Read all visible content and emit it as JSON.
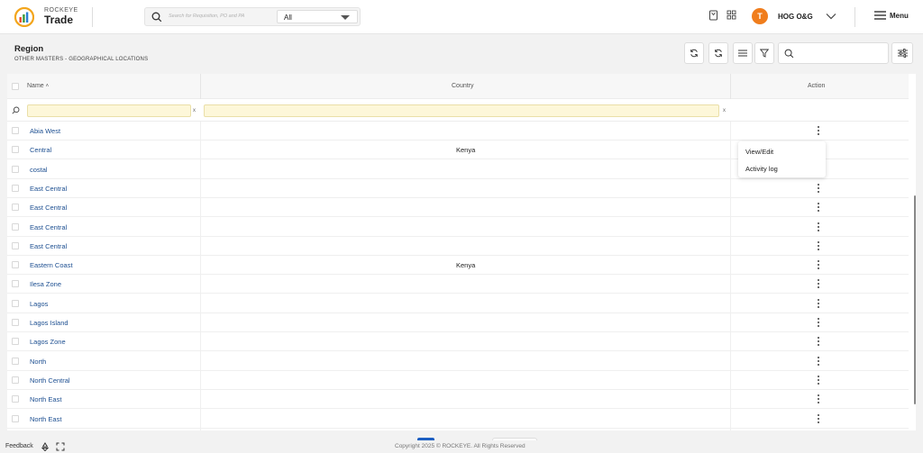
{
  "header": {
    "brand_small": "ROCKEYE",
    "brand_big": "Trade",
    "search_placeholder": "Search for Requisition, PO and PA",
    "search_scope": "All",
    "avatar_letter": "T",
    "user_name": "HOG O&G",
    "menu_label": "Menu"
  },
  "page": {
    "title": "Region",
    "breadcrumb": "OTHER MASTERS -  GEOGRAPHICAL LOCATIONS"
  },
  "grid": {
    "columns": {
      "name": "Name",
      "name_sort": "˄",
      "country": "Country",
      "action": "Action"
    },
    "filter_clear": "x",
    "rows": [
      {
        "name": "Abia West",
        "country": ""
      },
      {
        "name": "Central",
        "country": "Kenya"
      },
      {
        "name": "costal",
        "country": ""
      },
      {
        "name": "East Central",
        "country": ""
      },
      {
        "name": "East Central",
        "country": ""
      },
      {
        "name": "East Central",
        "country": ""
      },
      {
        "name": "East Central",
        "country": ""
      },
      {
        "name": "Eastern Coast",
        "country": "Kenya"
      },
      {
        "name": "Ilesa Zone",
        "country": ""
      },
      {
        "name": "Lagos",
        "country": ""
      },
      {
        "name": "Lagos Island",
        "country": ""
      },
      {
        "name": "Lagos Zone",
        "country": ""
      },
      {
        "name": "North",
        "country": ""
      },
      {
        "name": "North Central",
        "country": ""
      },
      {
        "name": "North East",
        "country": ""
      },
      {
        "name": "North East",
        "country": ""
      }
    ]
  },
  "action_menu": {
    "view_edit": "View/Edit",
    "activity_log": "Activity log"
  },
  "footer": {
    "feedback": "Feedback",
    "copyright": "Copyright 2025 © ROCKEYE. All Rights Reserved"
  },
  "colors": {
    "accent": "#1d5fc2",
    "link": "#1d4f91",
    "avatar": "#f07d1c",
    "filter_bg": "#fdf7d9"
  }
}
